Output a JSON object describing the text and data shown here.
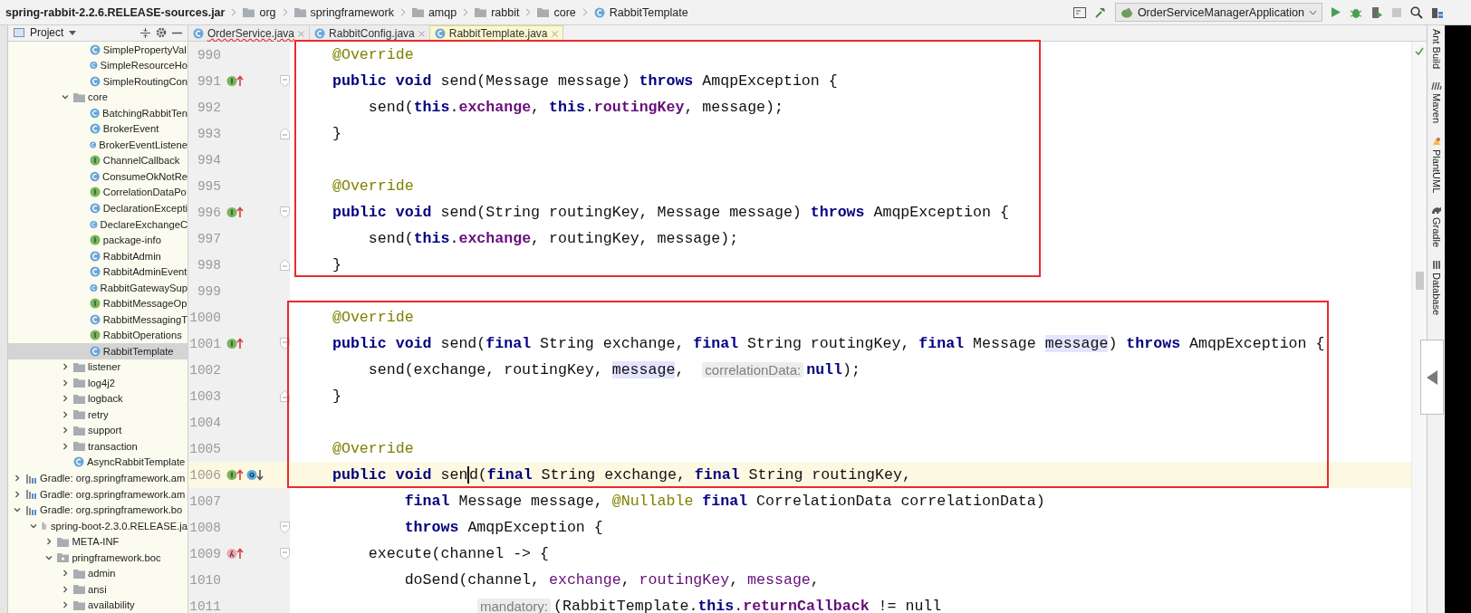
{
  "breadcrumb": [
    {
      "label": "spring-rabbit-2.2.6.RELEASE-sources.jar",
      "kind": "jar"
    },
    {
      "label": "org",
      "kind": "folder"
    },
    {
      "label": "springframework",
      "kind": "folder"
    },
    {
      "label": "amqp",
      "kind": "folder"
    },
    {
      "label": "rabbit",
      "kind": "folder"
    },
    {
      "label": "core",
      "kind": "folder"
    },
    {
      "label": "RabbitTemplate",
      "kind": "class"
    }
  ],
  "run_configuration": "OrderServiceManagerApplication",
  "project_panel": {
    "title": "Project"
  },
  "tree": [
    {
      "children": [
        {
          "children": [
            {
              "children": [
                {
                  "children": [
                    {
                      "label": "SimplePropertyVal",
                      "kind": "class"
                    },
                    {
                      "label": "SimpleResourceHo",
                      "kind": "class"
                    },
                    {
                      "label": "SimpleRoutingCon",
                      "kind": "class"
                    }
                  ]
                },
                {
                  "label": "core",
                  "kind": "folder",
                  "expanded": true,
                  "children": [
                    {
                      "label": "BatchingRabbitTen",
                      "kind": "class"
                    },
                    {
                      "label": "BrokerEvent",
                      "kind": "class"
                    },
                    {
                      "label": "BrokerEventListene",
                      "kind": "class"
                    },
                    {
                      "label": "ChannelCallback",
                      "kind": "interface"
                    },
                    {
                      "label": "ConsumeOkNotRe",
                      "kind": "class"
                    },
                    {
                      "label": "CorrelationDataPo",
                      "kind": "interface"
                    },
                    {
                      "label": "DeclarationExcepti",
                      "kind": "class"
                    },
                    {
                      "label": "DeclareExchangeC",
                      "kind": "class"
                    },
                    {
                      "label": "package-info",
                      "kind": "interface"
                    },
                    {
                      "label": "RabbitAdmin",
                      "kind": "class"
                    },
                    {
                      "label": "RabbitAdminEvent",
                      "kind": "class"
                    },
                    {
                      "label": "RabbitGatewaySup",
                      "kind": "class"
                    },
                    {
                      "label": "RabbitMessageOp",
                      "kind": "interface"
                    },
                    {
                      "label": "RabbitMessagingT",
                      "kind": "class"
                    },
                    {
                      "label": "RabbitOperations",
                      "kind": "interface"
                    },
                    {
                      "label": "RabbitTemplate",
                      "kind": "class",
                      "selected": true
                    }
                  ]
                },
                {
                  "label": "listener",
                  "kind": "folder",
                  "expanded": false
                },
                {
                  "label": "log4j2",
                  "kind": "folder",
                  "expanded": false
                },
                {
                  "label": "logback",
                  "kind": "folder",
                  "expanded": false
                },
                {
                  "label": "retry",
                  "kind": "folder",
                  "expanded": false
                },
                {
                  "label": "support",
                  "kind": "folder",
                  "expanded": false
                },
                {
                  "label": "transaction",
                  "kind": "folder",
                  "expanded": false
                },
                {
                  "label": "AsyncRabbitTemplate",
                  "kind": "class"
                }
              ]
            }
          ]
        }
      ]
    },
    {
      "label": "Gradle: org.springframework.am",
      "kind": "library",
      "expanded": false
    },
    {
      "label": "Gradle: org.springframework.am",
      "kind": "library",
      "expanded": false
    },
    {
      "label": "Gradle: org.springframework.bo",
      "kind": "library",
      "expanded": true,
      "children": [
        {
          "label": "spring-boot-2.3.0.RELEASE.ja",
          "kind": "jar",
          "expanded": true,
          "children": [
            {
              "label": "META-INF",
              "kind": "folder",
              "expanded": false
            },
            {
              "label": "pringframework.boc",
              "kind": "package",
              "expanded": true,
              "children": [
                {
                  "label": "admin",
                  "kind": "folder",
                  "expanded": false
                },
                {
                  "label": "ansi",
                  "kind": "folder",
                  "expanded": false
                },
                {
                  "label": "availability",
                  "kind": "folder",
                  "expanded": false
                }
              ]
            }
          ]
        }
      ]
    }
  ],
  "tabs": [
    {
      "label": "OrderService.java",
      "selected": false,
      "error": true
    },
    {
      "label": "RabbitConfig.java",
      "selected": false,
      "error": false
    },
    {
      "label": "RabbitTemplate.java",
      "selected": true,
      "error": false
    }
  ],
  "code_lines": [
    {
      "number": "990",
      "tokens": [
        {
          "kind": "ann",
          "t": "@Override"
        }
      ]
    },
    {
      "number": "991",
      "fold": {
        "kind": "start"
      },
      "markers": [
        {
          "kind": "implements"
        }
      ],
      "tokens": [
        {
          "kind": "kw",
          "t": "public void "
        },
        {
          "kind": "p",
          "t": "send(Message message) "
        },
        {
          "kind": "kw",
          "t": "throws "
        },
        {
          "kind": "p",
          "t": "AmqpException {"
        }
      ]
    },
    {
      "number": "992",
      "tokens": [
        {
          "kind": "p",
          "t": "    send("
        },
        {
          "kind": "kw",
          "t": "this"
        },
        {
          "kind": "p",
          "t": "."
        },
        {
          "kind": "f",
          "t": "exchange"
        },
        {
          "kind": "p",
          "t": ", "
        },
        {
          "kind": "kw",
          "t": "this"
        },
        {
          "kind": "p",
          "t": "."
        },
        {
          "kind": "f",
          "t": "routingKey"
        },
        {
          "kind": "p",
          "t": ", message);"
        }
      ]
    },
    {
      "number": "993",
      "fold": {
        "kind": "end"
      },
      "tokens": [
        {
          "kind": "p",
          "t": "}"
        }
      ]
    },
    {
      "number": "994"
    },
    {
      "number": "995",
      "tokens": [
        {
          "kind": "ann",
          "t": "@Override"
        }
      ]
    },
    {
      "number": "996",
      "fold": {
        "kind": "start"
      },
      "markers": [
        {
          "kind": "implements"
        }
      ],
      "tokens": [
        {
          "kind": "kw",
          "t": "public void "
        },
        {
          "kind": "p",
          "t": "send(String routingKey, Message message) "
        },
        {
          "kind": "kw",
          "t": "throws "
        },
        {
          "kind": "p",
          "t": "AmqpException {"
        }
      ]
    },
    {
      "number": "997",
      "tokens": [
        {
          "kind": "p",
          "t": "    send("
        },
        {
          "kind": "kw",
          "t": "this"
        },
        {
          "kind": "p",
          "t": "."
        },
        {
          "kind": "f",
          "t": "exchange"
        },
        {
          "kind": "p",
          "t": ", routingKey, message);"
        }
      ]
    },
    {
      "number": "998",
      "fold": {
        "kind": "end"
      },
      "tokens": [
        {
          "kind": "p",
          "t": "}"
        }
      ]
    },
    {
      "number": "999"
    },
    {
      "number": "1000",
      "tokens": [
        {
          "kind": "ann",
          "t": "@Override"
        }
      ]
    },
    {
      "number": "1001",
      "fold": {
        "kind": "start"
      },
      "markers": [
        {
          "kind": "implements"
        }
      ],
      "tokens": [
        {
          "kind": "kw",
          "t": "public void "
        },
        {
          "kind": "p",
          "t": "send("
        },
        {
          "kind": "kw",
          "t": "final "
        },
        {
          "kind": "p",
          "t": "String exchange, "
        },
        {
          "kind": "kw",
          "t": "final "
        },
        {
          "kind": "p",
          "t": "String routingKey, "
        },
        {
          "kind": "kw",
          "t": "final "
        },
        {
          "kind": "p",
          "t": "Message "
        },
        {
          "kind": "hl",
          "t": "message"
        },
        {
          "kind": "p",
          "t": ") "
        },
        {
          "kind": "kw",
          "t": "throws "
        },
        {
          "kind": "p",
          "t": "AmqpException {"
        }
      ]
    },
    {
      "number": "1002",
      "tokens": [
        {
          "kind": "p",
          "t": "    send(exchange, routingKey, "
        },
        {
          "kind": "hl",
          "t": "message"
        },
        {
          "kind": "p",
          "t": ",  "
        },
        {
          "kind": "hint",
          "t": "correlationData:"
        },
        {
          "kind": "kw",
          "t": "null"
        },
        {
          "kind": "p",
          "t": ");"
        }
      ]
    },
    {
      "number": "1003",
      "fold": {
        "kind": "end"
      },
      "tokens": [
        {
          "kind": "p",
          "t": "}"
        }
      ]
    },
    {
      "number": "1004"
    },
    {
      "number": "1005",
      "tokens": [
        {
          "kind": "ann",
          "t": "@Override"
        }
      ]
    },
    {
      "number": "1006",
      "current": true,
      "markers": [
        {
          "kind": "implements"
        },
        {
          "kind": "overridden"
        }
      ],
      "tokens": [
        {
          "kind": "kw",
          "t": "public void "
        },
        {
          "kind": "p",
          "t": "sen"
        },
        {
          "kind": "caret"
        },
        {
          "kind": "p",
          "t": "d("
        },
        {
          "kind": "kw",
          "t": "final "
        },
        {
          "kind": "p",
          "t": "String exchange, "
        },
        {
          "kind": "kw",
          "t": "final "
        },
        {
          "kind": "p",
          "t": "String routingKey,"
        }
      ]
    },
    {
      "number": "1007",
      "tokens": [
        {
          "kind": "kw",
          "t": "        final "
        },
        {
          "kind": "p",
          "t": "Message message, "
        },
        {
          "kind": "ann",
          "t": "@Nullable "
        },
        {
          "kind": "kw",
          "t": "final "
        },
        {
          "kind": "p",
          "t": "CorrelationData correlationData)"
        }
      ]
    },
    {
      "number": "1008",
      "fold": {
        "kind": "start"
      },
      "tokens": [
        {
          "kind": "kw",
          "t": "        throws "
        },
        {
          "kind": "p",
          "t": "AmqpException {"
        }
      ]
    },
    {
      "number": "1009",
      "fold": {
        "kind": "start"
      },
      "markers": [
        {
          "kind": "lambda"
        }
      ],
      "tokens": [
        {
          "kind": "p",
          "t": "    execute(channel -> {"
        }
      ]
    },
    {
      "number": "1010",
      "tokens": [
        {
          "kind": "p",
          "t": "        doSend(channel, "
        },
        {
          "kind": "cap",
          "t": "exchange"
        },
        {
          "kind": "p",
          "t": ", "
        },
        {
          "kind": "cap",
          "t": "routingKey"
        },
        {
          "kind": "p",
          "t": ", "
        },
        {
          "kind": "cap",
          "t": "message"
        },
        {
          "kind": "p",
          "t": ","
        }
      ]
    },
    {
      "number": "1011",
      "continuation": true,
      "tokens": [
        {
          "kind": "hint",
          "t": "mandatory:"
        },
        {
          "kind": "p",
          "t": "(RabbitTemplate."
        },
        {
          "kind": "kw",
          "t": "this"
        },
        {
          "kind": "p",
          "t": "."
        },
        {
          "kind": "f",
          "t": "returnCallback"
        },
        {
          "kind": "p",
          "t": " != null"
        }
      ]
    }
  ],
  "tool_windows": [
    "Ant Build",
    "Maven",
    "PlantUML",
    "Gradle",
    "Database"
  ]
}
